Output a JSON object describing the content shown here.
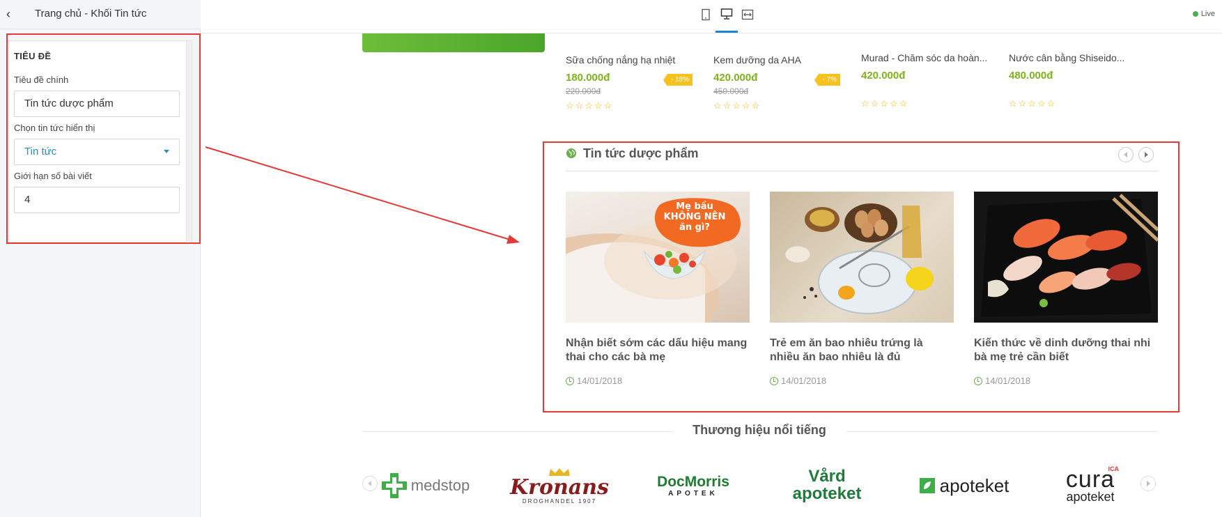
{
  "sidebar": {
    "title": "Trang chủ - Khối Tin tức",
    "section": "TIÊU ĐỀ",
    "main_title_label": "Tiêu đề chính",
    "main_title_value": "Tin tức dược phẩm",
    "select_label": "Chọn tin tức hiển thị",
    "select_value": "Tin tức",
    "limit_label": "Giới hạn số bài viết",
    "limit_value": "4"
  },
  "toolbar": {
    "devices": [
      "mobile-icon",
      "desktop-icon",
      "fullwidth-icon"
    ],
    "active_device": "desktop-icon",
    "live_label": "Live"
  },
  "products": [
    {
      "name": "Sữa chống nắng hạ nhiệt",
      "price": "180.000đ",
      "old_price": "220.000đ",
      "badge": "- 18%",
      "stars": "☆☆☆☆☆"
    },
    {
      "name": "Kem dưỡng da AHA",
      "price": "420.000đ",
      "old_price": "450.000đ",
      "badge": "- 7%",
      "stars": "☆☆☆☆☆"
    },
    {
      "name": "Murad - Chăm sóc da hoàn...",
      "price": "420.000đ",
      "old_price": "",
      "badge": "",
      "stars": "☆☆☆☆☆"
    },
    {
      "name": "Nước cân bằng Shiseido...",
      "price": "480.000đ",
      "old_price": "",
      "badge": "",
      "stars": "☆☆☆☆☆"
    }
  ],
  "news": {
    "title": "Tin tức dược phẩm",
    "articles": [
      {
        "title": "Nhận biết sớm các dấu hiệu mang thai cho các bà mẹ",
        "date": "14/01/2018",
        "image_text": "Mẹ bầu KHÔNG NÊN ăn gì?"
      },
      {
        "title": "Trẻ em ăn bao nhiêu trứng là nhiều ăn bao nhiêu là đủ",
        "date": "14/01/2018"
      },
      {
        "title": "Kiến thức về dinh dưỡng thai nhi bà mẹ trẻ cần biết",
        "date": "14/01/2018"
      }
    ]
  },
  "brands": {
    "title": "Thương hiệu nổi tiếng",
    "items": [
      "medstop",
      "Kronans",
      "DROGHANDEL 1907",
      "DocMorris",
      "APOTEK",
      "Vård",
      "apoteket",
      "apoteket",
      "ICA",
      "cura",
      "apoteket"
    ]
  },
  "colors": {
    "accent": "#1a87d6",
    "price": "#7cb518",
    "highlight": "#e53935",
    "badge": "#f7c21d"
  }
}
